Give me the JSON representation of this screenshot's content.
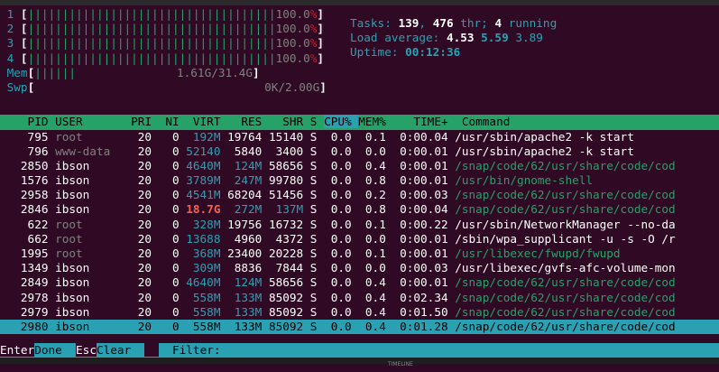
{
  "meters": {
    "cpus": [
      {
        "num": "1",
        "bars": "||||||||||||||||||||||||||||||||||||",
        "value": "100.0%"
      },
      {
        "num": "2",
        "bars": "||||||||||||||||||||||||||||||||||||",
        "value": "100.0%"
      },
      {
        "num": "3",
        "bars": "||||||||||||||||||||||||||||||||||||",
        "value": "100.0%"
      },
      {
        "num": "4",
        "bars": "||||||||||||||||||||||||||||||||||||",
        "value": "100.0%"
      }
    ],
    "mem": {
      "label": "Mem",
      "bars": "||||||",
      "value": "1.61G/31.4G"
    },
    "swp": {
      "label": "Swp",
      "value": "0K/2.00G"
    }
  },
  "summary": {
    "tasks_label": "Tasks: ",
    "tasks": "139",
    "thr": "476",
    "thr_label": " thr; ",
    "running": "4",
    "running_label": " running",
    "load_label": "Load average: ",
    "load1": "4.53",
    "load5": "5.59",
    "load15": "3.89",
    "uptime_label": "Uptime: ",
    "uptime": "00:12:36"
  },
  "columns": [
    "PID",
    "USER",
    "PRI",
    "NI",
    "VIRT",
    "RES",
    "SHR",
    "S",
    "CPU%",
    "MEM%",
    "TIME+",
    "Command"
  ],
  "processes": [
    {
      "pid": "795",
      "user": "root",
      "pri": "20",
      "ni": "0",
      "virt": "192M",
      "res": "19764",
      "shr": "15140",
      "s": "S",
      "cpu": "0.0",
      "mem": "0.1",
      "time": "0:00.04",
      "cmd": "/usr/sbin/apache2 -k start"
    },
    {
      "pid": "796",
      "user": "www-data",
      "pri": "20",
      "ni": "0",
      "virt": "52140",
      "res": "5840",
      "shr": "3400",
      "s": "S",
      "cpu": "0.0",
      "mem": "0.0",
      "time": "0:00.01",
      "cmd": "/usr/sbin/apache2 -k start"
    },
    {
      "pid": "2850",
      "user": "ibson",
      "pri": "20",
      "ni": "0",
      "virt": "4640M",
      "res": "124M",
      "shr": "58656",
      "s": "S",
      "cpu": "0.0",
      "mem": "0.4",
      "time": "0:00.01",
      "cmd": "/snap/code/62/usr/share/code/cod"
    },
    {
      "pid": "1576",
      "user": "ibson",
      "pri": "20",
      "ni": "0",
      "virt": "3789M",
      "res": "247M",
      "shr": "99780",
      "s": "S",
      "cpu": "0.0",
      "mem": "0.8",
      "time": "0:00.01",
      "cmd": "/usr/bin/gnome-shell"
    },
    {
      "pid": "2958",
      "user": "ibson",
      "pri": "20",
      "ni": "0",
      "virt": "4541M",
      "res": "68204",
      "shr": "51456",
      "s": "S",
      "cpu": "0.0",
      "mem": "0.2",
      "time": "0:00.03",
      "cmd": "/snap/code/62/usr/share/code/cod"
    },
    {
      "pid": "2846",
      "user": "ibson",
      "pri": "20",
      "ni": "0",
      "virt": "18.7G",
      "res": "272M",
      "shr": "137M",
      "s": "S",
      "cpu": "0.0",
      "mem": "0.8",
      "time": "0:00.04",
      "cmd": "/snap/code/62/usr/share/code/cod"
    },
    {
      "pid": "622",
      "user": "root",
      "pri": "20",
      "ni": "0",
      "virt": "328M",
      "res": "19756",
      "shr": "16732",
      "s": "S",
      "cpu": "0.0",
      "mem": "0.1",
      "time": "0:00.22",
      "cmd": "/usr/sbin/NetworkManager --no-da"
    },
    {
      "pid": "662",
      "user": "root",
      "pri": "20",
      "ni": "0",
      "virt": "13688",
      "res": "4960",
      "shr": "4372",
      "s": "S",
      "cpu": "0.0",
      "mem": "0.0",
      "time": "0:00.01",
      "cmd": "/sbin/wpa_supplicant -u -s -O /r"
    },
    {
      "pid": "1995",
      "user": "root",
      "pri": "20",
      "ni": "0",
      "virt": "368M",
      "res": "23400",
      "shr": "20228",
      "s": "S",
      "cpu": "0.0",
      "mem": "0.1",
      "time": "0:00.01",
      "cmd": "/usr/libexec/fwupd/fwupd"
    },
    {
      "pid": "1349",
      "user": "ibson",
      "pri": "20",
      "ni": "0",
      "virt": "309M",
      "res": "8836",
      "shr": "7844",
      "s": "S",
      "cpu": "0.0",
      "mem": "0.0",
      "time": "0:00.03",
      "cmd": "/usr/libexec/gvfs-afc-volume-mon"
    },
    {
      "pid": "2849",
      "user": "ibson",
      "pri": "20",
      "ni": "0",
      "virt": "4640M",
      "res": "124M",
      "shr": "58656",
      "s": "S",
      "cpu": "0.0",
      "mem": "0.4",
      "time": "0:00.01",
      "cmd": "/snap/code/62/usr/share/code/cod"
    },
    {
      "pid": "2978",
      "user": "ibson",
      "pri": "20",
      "ni": "0",
      "virt": "558M",
      "res": "133M",
      "shr": "85092",
      "s": "S",
      "cpu": "0.0",
      "mem": "0.4",
      "time": "0:02.34",
      "cmd": "/snap/code/62/usr/share/code/cod"
    },
    {
      "pid": "2979",
      "user": "ibson",
      "pri": "20",
      "ni": "0",
      "virt": "558M",
      "res": "133M",
      "shr": "85092",
      "s": "S",
      "cpu": "0.0",
      "mem": "0.4",
      "time": "0:01.50",
      "cmd": "/snap/code/62/usr/share/code/cod"
    },
    {
      "pid": "2980",
      "user": "ibson",
      "pri": "20",
      "ni": "0",
      "virt": "558M",
      "res": "133M",
      "shr": "85092",
      "s": "S",
      "cpu": "0.0",
      "mem": "0.4",
      "time": "0:01.28",
      "cmd": "/snap/code/62/usr/share/code/cod"
    }
  ],
  "footer": {
    "enter_key": "Enter",
    "enter_label": "Done  ",
    "esc_key": "Esc",
    "esc_label": "Clear  ",
    "filter_label": "  Filter: "
  },
  "taskbar": {
    "label": "TIMELINE"
  },
  "colors": {
    "background": "#300a24",
    "accent_green": "#26a269",
    "accent_cyan": "#2aa1b3",
    "alert_red": "#f66151"
  }
}
